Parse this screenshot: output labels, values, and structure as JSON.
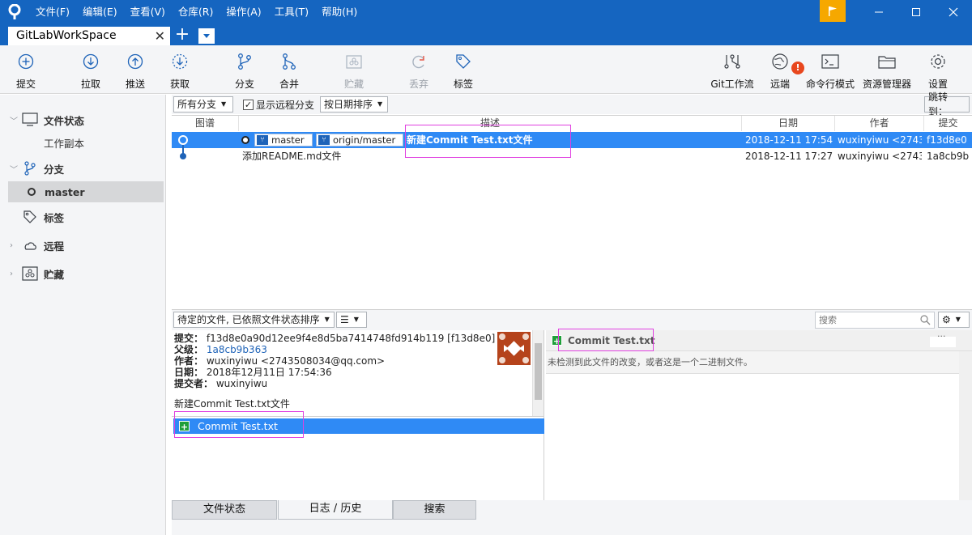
{
  "menu": [
    "文件(F)",
    "编辑(E)",
    "查看(V)",
    "仓库(R)",
    "操作(A)",
    "工具(T)",
    "帮助(H)"
  ],
  "tabs": {
    "active": "GitLabWorkSpace",
    "add": "+"
  },
  "toolbar": {
    "commit": "提交",
    "pull": "拉取",
    "push": "推送",
    "fetch": "获取",
    "branch": "分支",
    "merge": "合并",
    "stash": "贮藏",
    "discard": "丢弃",
    "tag": "标签",
    "gitflow": "Git工作流",
    "remote": "远端",
    "terminal": "命令行模式",
    "explorer": "资源管理器",
    "settings": "设置"
  },
  "sidebar": {
    "file_status": "文件状态",
    "working_copy": "工作副本",
    "branches": "分支",
    "master": "master",
    "tags": "标签",
    "remotes": "远程",
    "stashes": "贮藏"
  },
  "filter": {
    "branches": "所有分支",
    "show_remote": "显示远程分支",
    "sort": "按日期排序",
    "jump": "跳转到："
  },
  "columns": {
    "graph": "图谱",
    "desc": "描述",
    "date": "日期",
    "author": "作者",
    "commit": "提交"
  },
  "commits": [
    {
      "ref1": "master",
      "ref2": "origin/master",
      "desc": "新建Commit Test.txt文件",
      "date": "2018-12-11 17:54",
      "author": "wuxinyiwu <2743",
      "hash": "f13d8e0"
    },
    {
      "desc": "添加README.md文件",
      "date": "2018-12-11 17:27",
      "author": "wuxinyiwu <2743",
      "hash": "1a8cb9b"
    }
  ],
  "lower": {
    "pending_sort": "待定的文件, 已依照文件状态排序",
    "search_placeholder": "搜索"
  },
  "detail": {
    "commit_label": "提交：",
    "commit_value": "f13d8e0a90d12ee9f4e8d5ba7414748fd914b119 [f13d8e0]",
    "parent_label": "父级：",
    "parent_value": "1a8cb9b363",
    "author_label": "作者：",
    "author_value": "wuxinyiwu <2743508034@qq.com>",
    "date_label": "日期：",
    "date_value": "2018年12月11日 17:54:36",
    "committer_label": "提交者：",
    "committer_value": "wuxinyiwu",
    "message": "新建Commit Test.txt文件"
  },
  "files": [
    {
      "name": "Commit Test.txt"
    }
  ],
  "diff": {
    "file": "Commit Test.txt",
    "dots": "...",
    "message": "未检测到此文件的改变，或者这是一个二进制文件。"
  },
  "bottom_tabs": [
    "文件状态",
    "日志 / 历史",
    "搜索"
  ],
  "colors": {
    "titlebar": "#1565c0",
    "selection": "#2f8af5",
    "accent": "#f6a800",
    "add": "#1f9e3a",
    "highlight": "#e040e0"
  }
}
